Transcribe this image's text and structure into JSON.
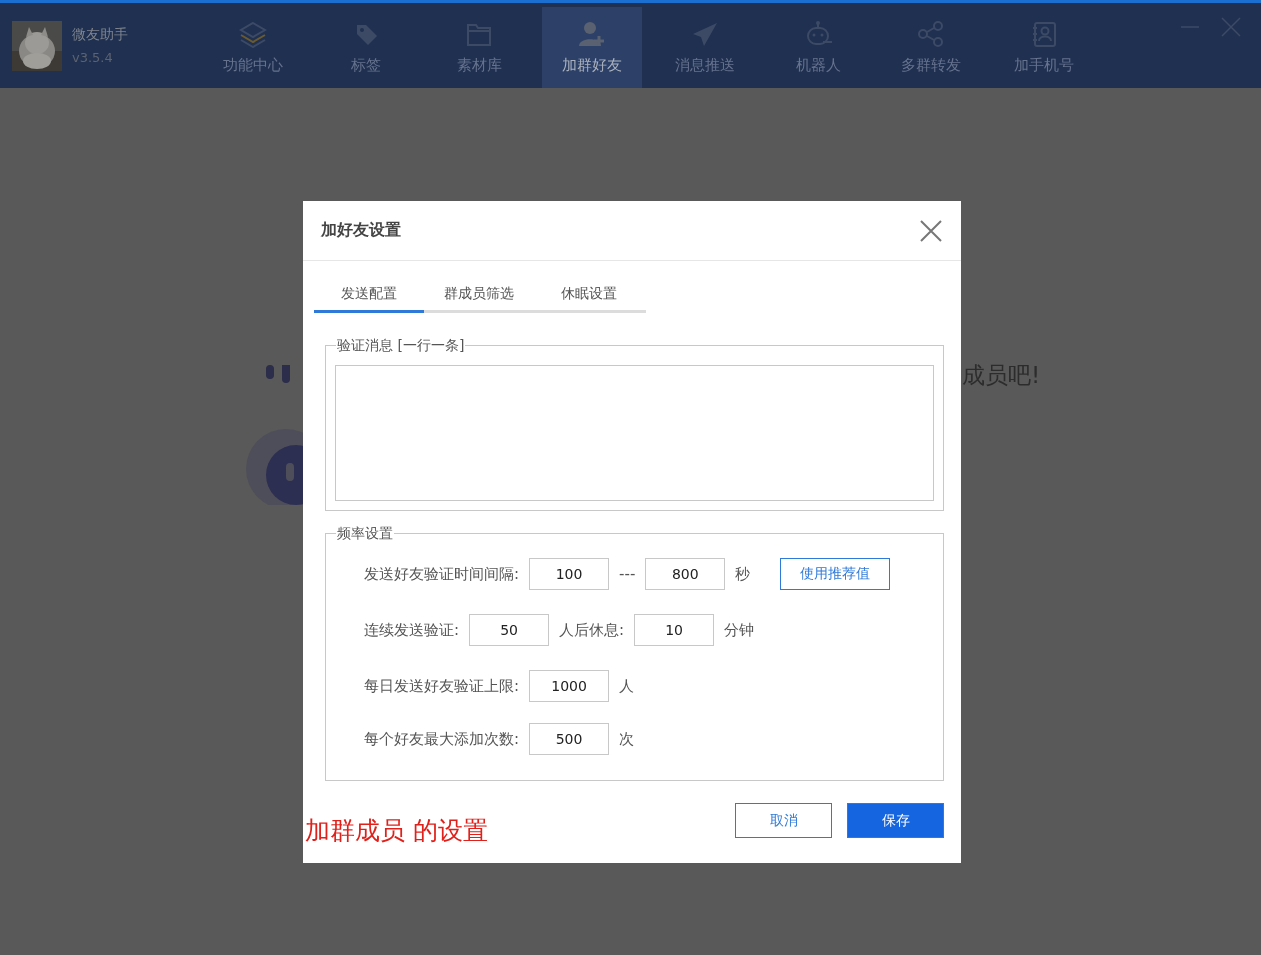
{
  "app": {
    "name": "微友助手",
    "version": "v3.5.4"
  },
  "nav": [
    {
      "label": "功能中心",
      "selected": false
    },
    {
      "label": "标签",
      "selected": false
    },
    {
      "label": "素材库",
      "selected": false
    },
    {
      "label": "加群好友",
      "selected": true
    },
    {
      "label": "消息推送",
      "selected": false
    },
    {
      "label": "机器人",
      "selected": false
    },
    {
      "label": "多群转发",
      "selected": false
    },
    {
      "label": "加手机号",
      "selected": false
    }
  ],
  "background": {
    "message": "成员吧!"
  },
  "dialog": {
    "title": "加好友设置",
    "tabs": [
      {
        "label": "发送配置",
        "selected": true
      },
      {
        "label": "群成员筛选",
        "selected": false
      },
      {
        "label": "休眠设置",
        "selected": false
      }
    ],
    "message_group": {
      "legend": "验证消息 [一行一条]"
    },
    "frequency_group": {
      "legend": "频率设置",
      "rows": [
        {
          "parts": [
            {
              "kind": "text",
              "text": "发送好友验证时间间隔:"
            },
            {
              "kind": "input",
              "value": "100"
            },
            {
              "kind": "text",
              "text": "---"
            },
            {
              "kind": "input",
              "value": "800"
            },
            {
              "kind": "text",
              "text": "秒"
            },
            {
              "kind": "button",
              "label": "使用推荐值"
            }
          ]
        },
        {
          "parts": [
            {
              "kind": "text",
              "text": "连续发送验证:"
            },
            {
              "kind": "input",
              "value": "50"
            },
            {
              "kind": "text",
              "text": "人后休息:"
            },
            {
              "kind": "input",
              "value": "10"
            },
            {
              "kind": "text",
              "text": "分钟"
            }
          ]
        },
        {
          "parts": [
            {
              "kind": "text",
              "text": "每日发送好友验证上限:"
            },
            {
              "kind": "input",
              "value": "1000"
            },
            {
              "kind": "text",
              "text": "人"
            }
          ]
        },
        {
          "parts": [
            {
              "kind": "text",
              "text": "每个好友最大添加次数:"
            },
            {
              "kind": "input",
              "value": "500"
            },
            {
              "kind": "text",
              "text": "次"
            }
          ]
        }
      ]
    },
    "annotation": "加群成员 的设置",
    "buttons": [
      {
        "label": "取消",
        "kind": "secondary"
      },
      {
        "label": "保存",
        "kind": "primary"
      }
    ]
  }
}
